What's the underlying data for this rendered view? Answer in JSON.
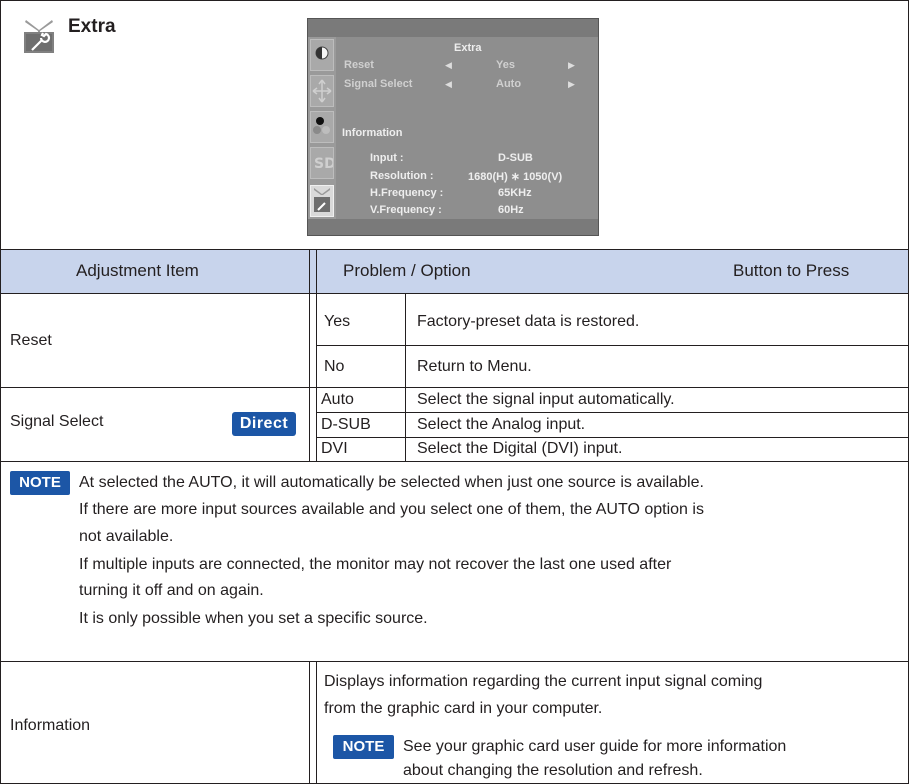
{
  "section": {
    "title": "Extra",
    "icon": "wrench-tv-icon"
  },
  "osd": {
    "title": "Extra",
    "rows": [
      {
        "label": "Reset",
        "value": "Yes"
      },
      {
        "label": "Signal Select",
        "value": "Auto"
      }
    ],
    "info_heading": "Information",
    "info": [
      {
        "label": "Input :",
        "value": "D-SUB"
      },
      {
        "label": "Resolution :",
        "value": "1680(H) ∗ 1050(V)"
      },
      {
        "label": "H.Frequency :",
        "value": "65KHz"
      },
      {
        "label": "V.Frequency :",
        "value": "60Hz"
      }
    ],
    "side_icons": [
      "contrast-icon",
      "position-icon",
      "color-icon",
      "osd-icon",
      "extra-icon"
    ]
  },
  "table": {
    "headers": {
      "item": "Adjustment Item",
      "option": "Problem / Option",
      "button": "Button to Press"
    },
    "reset": {
      "label": "Reset",
      "options": [
        {
          "option": "Yes",
          "desc": "Factory-preset data is restored."
        },
        {
          "option": "No",
          "desc": "Return to Menu."
        }
      ]
    },
    "signal_select": {
      "label": "Signal Select",
      "badge": "Direct",
      "options": [
        {
          "option": "Auto",
          "desc": "Select the signal input automatically."
        },
        {
          "option": "D-SUB",
          "desc": "Select the Analog input."
        },
        {
          "option": "DVI",
          "desc": "Select the Digital (DVI) input."
        }
      ]
    },
    "note": {
      "badge": "NOTE",
      "lines": [
        "At selected the AUTO, it will automatically be selected when just one source is available.",
        "If there are more input sources available and you select one of them, the AUTO option is",
        "not available.",
        "If multiple inputs are connected, the monitor may not recover the last one used after",
        "turning it off and on again.",
        "It is only possible when you set a specific source."
      ]
    },
    "information": {
      "label": "Information",
      "desc_lines": [
        "Displays information regarding the current input signal coming",
        "from the graphic card in your computer."
      ],
      "note_badge": "NOTE",
      "note_lines": [
        "See your graphic card user guide for more information",
        "about changing the resolution and refresh."
      ]
    }
  },
  "colors": {
    "header_bg": "#c8d4ec",
    "badge_blue": "#1c56a6"
  }
}
